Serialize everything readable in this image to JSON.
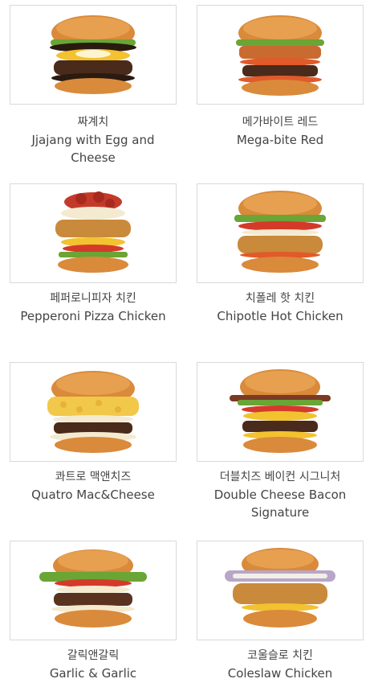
{
  "menu": {
    "items": [
      {
        "name_ko": "짜계치",
        "name_en": "Jjajang with Egg and Cheese",
        "image_icon": "burger-jjajang-egg-cheese"
      },
      {
        "name_ko": "메가바이트 레드",
        "name_en": "Mega-bite Red",
        "image_icon": "burger-mega-bite-red"
      },
      {
        "name_ko": "페퍼로니피자 치킨",
        "name_en": "Pepperoni Pizza Chicken",
        "image_icon": "burger-pepperoni-pizza-chicken"
      },
      {
        "name_ko": "치폴레 핫 치킨",
        "name_en": "Chipotle Hot Chicken",
        "image_icon": "burger-chipotle-hot-chicken"
      },
      {
        "name_ko": "콰트로 맥앤치즈",
        "name_en": "Quatro Mac&Cheese",
        "image_icon": "burger-quatro-mac-cheese"
      },
      {
        "name_ko": "더블치즈 베이컨 시그니처",
        "name_en": "Double Cheese Bacon Signature",
        "image_icon": "burger-double-cheese-bacon-signature"
      },
      {
        "name_ko": "갈릭앤갈릭",
        "name_en": "Garlic & Garlic",
        "image_icon": "burger-garlic-and-garlic"
      },
      {
        "name_ko": "코울슬로 치킨",
        "name_en": "Coleslaw Chicken",
        "image_icon": "burger-coleslaw-chicken"
      }
    ]
  },
  "colors": {
    "bun": "#d98a3a",
    "bun_dark": "#b86a24",
    "lettuce": "#6aa535",
    "cheese": "#f2c230",
    "patty": "#4a2a1a",
    "tomato": "#d43a2a",
    "fried_chicken": "#c98a3c",
    "card_border": "#d9d9d9"
  }
}
